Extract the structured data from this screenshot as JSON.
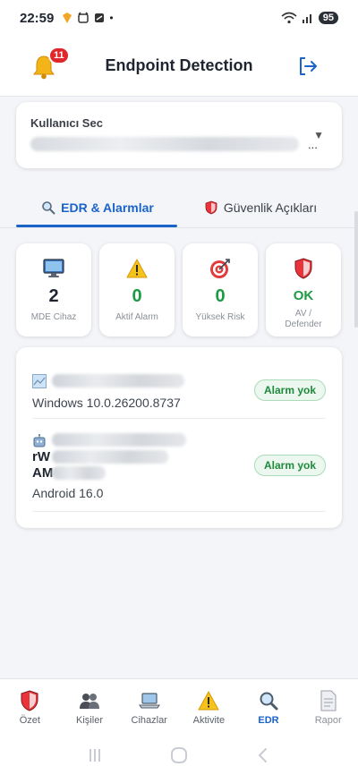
{
  "status_bar": {
    "time": "22:59",
    "battery": "95"
  },
  "header": {
    "title": "Endpoint Detection",
    "notification_count": "11"
  },
  "user_select": {
    "label": "Kullanıcı Sec",
    "ellipsis": "..."
  },
  "tabs": [
    {
      "label": "EDR & Alarmlar",
      "icon": "magnifier-icon",
      "active": true
    },
    {
      "label": "Güvenlik Açıkları",
      "icon": "shield-icon",
      "active": false
    }
  ],
  "stats": [
    {
      "icon": "monitor-icon",
      "value": "2",
      "label": "MDE Cihaz",
      "color": "#1f2530"
    },
    {
      "icon": "warning-icon",
      "value": "0",
      "label": "Aktif Alarm",
      "color": "#1e9a45"
    },
    {
      "icon": "target-icon",
      "value": "0",
      "label": "Yüksek Risk",
      "color": "#1e9a45"
    },
    {
      "icon": "shield-icon",
      "value": "OK",
      "label": "AV / Defender",
      "color": "#1e9a45"
    }
  ],
  "devices": [
    {
      "icon": "windows-icon",
      "name_fragment": "",
      "os": "Windows 10.0.26200.8737",
      "status": "Alarm yok"
    },
    {
      "icon": "android-robot-icon",
      "name_fragment_1": "rW",
      "name_fragment_2": "AM",
      "os": "Android 16.0",
      "status": "Alarm yok"
    }
  ],
  "bottom_nav": [
    {
      "label": "Özet",
      "icon": "shield-icon",
      "active": false
    },
    {
      "label": "Kişiler",
      "icon": "people-icon",
      "active": false
    },
    {
      "label": "Cihazlar",
      "icon": "laptop-icon",
      "active": false
    },
    {
      "label": "Aktivite",
      "icon": "warning-icon",
      "active": false
    },
    {
      "label": "EDR",
      "icon": "magnifier-icon",
      "active": true
    },
    {
      "label": "Rapor",
      "icon": "document-icon",
      "active": false
    }
  ],
  "colors": {
    "accent": "#1a63c8",
    "success": "#1e9a45",
    "danger": "#e0262b"
  }
}
